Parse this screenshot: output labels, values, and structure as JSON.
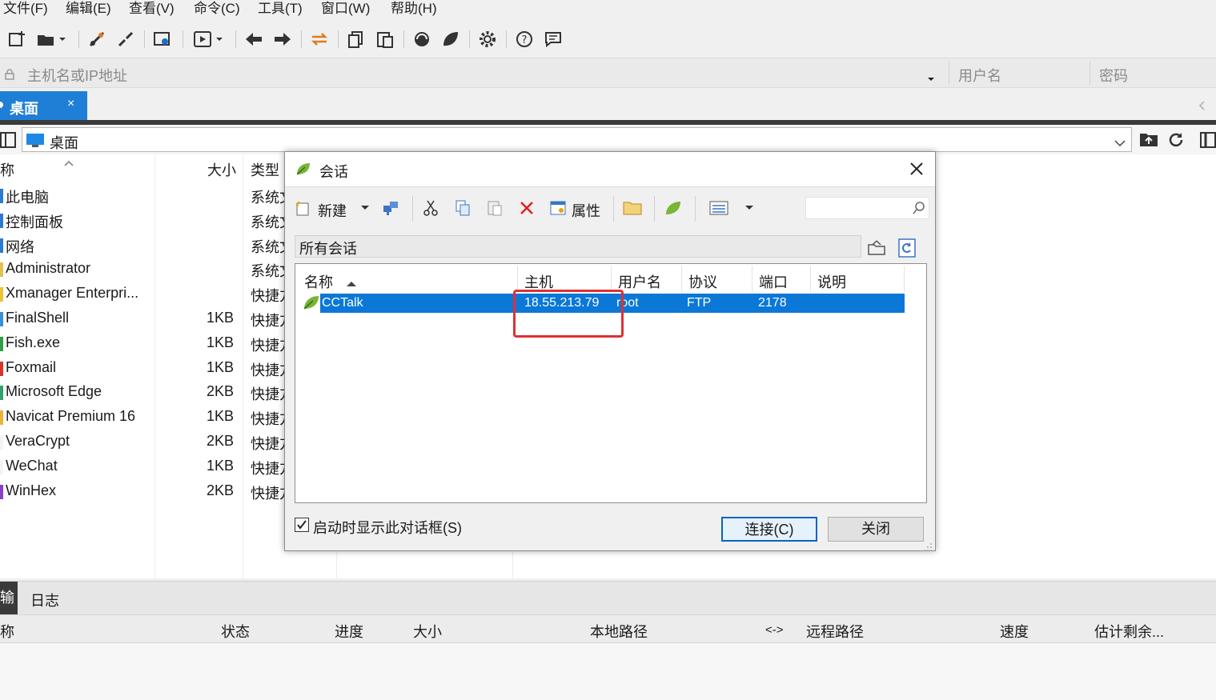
{
  "menu": [
    "文件(F)",
    "编辑(E)",
    "查看(V)",
    "命令(C)",
    "工具(T)",
    "窗口(W)",
    "帮助(H)"
  ],
  "address": {
    "host_placeholder": "主机名或IP地址",
    "user_placeholder": "用户名",
    "password_placeholder": "密码"
  },
  "tabs": [
    {
      "label": "桌面",
      "close": "×"
    }
  ],
  "path": {
    "label": "桌面"
  },
  "file_pane": {
    "headers": {
      "name": "称",
      "size": "大小",
      "type": "类型"
    },
    "rows": [
      {
        "name": "此电脑",
        "size": "",
        "type": "系统文件夹",
        "color": "#2b7bd1"
      },
      {
        "name": "控制面板",
        "size": "",
        "type": "系统文件夹",
        "color": "#2b7bd1"
      },
      {
        "name": "网络",
        "size": "",
        "type": "系统文件夹",
        "color": "#2b7bd1"
      },
      {
        "name": "Administrator",
        "size": "",
        "type": "系统文件夹",
        "color": "#e7c14c"
      },
      {
        "name": "Xmanager Enterpri...",
        "size": "",
        "type": "快捷方式",
        "color": "#f0c23a"
      },
      {
        "name": "FinalShell",
        "size": "1KB",
        "type": "快捷方式",
        "color": "#3b8fd6"
      },
      {
        "name": "Fish.exe",
        "size": "1KB",
        "type": "快捷方式",
        "color": "#2f9e44"
      },
      {
        "name": "Foxmail",
        "size": "1KB",
        "type": "快捷方式",
        "color": "#d9342b"
      },
      {
        "name": "Microsoft Edge",
        "size": "2KB",
        "type": "快捷方式",
        "color": "#2ea36b"
      },
      {
        "name": "Navicat Premium 16",
        "size": "1KB",
        "type": "快捷方式",
        "color": "#e9b43b"
      },
      {
        "name": "VeraCrypt",
        "size": "2KB",
        "type": "快捷方式",
        "color": "#f3f3f3"
      },
      {
        "name": "WeChat",
        "size": "1KB",
        "type": "快捷方式",
        "color": "#f3f3f3"
      },
      {
        "name": "WinHex",
        "size": "2KB",
        "type": "快捷方式",
        "color": "#8a3fc7"
      }
    ]
  },
  "log": {
    "tabs": [
      "输",
      "日志"
    ],
    "headers": [
      "称",
      "状态",
      "进度",
      "大小",
      "本地路径",
      "<->",
      "远程路径",
      "速度",
      "估计剩余..."
    ]
  },
  "dialog": {
    "title": "会话",
    "toolbar": {
      "new": "新建",
      "properties": "属性"
    },
    "folder": "所有会话",
    "columns": [
      "名称",
      "主机",
      "用户名",
      "协议",
      "端口",
      "说明"
    ],
    "sessions": [
      {
        "name": "CCTalk",
        "host": "18.55.213.79",
        "user": "root",
        "protocol": "FTP",
        "port": "2178",
        "desc": ""
      }
    ],
    "show_on_startup": "启动时显示此对话框(S)",
    "show_on_startup_checked": true,
    "connect_button": "连接(C)",
    "close_button": "关闭"
  }
}
